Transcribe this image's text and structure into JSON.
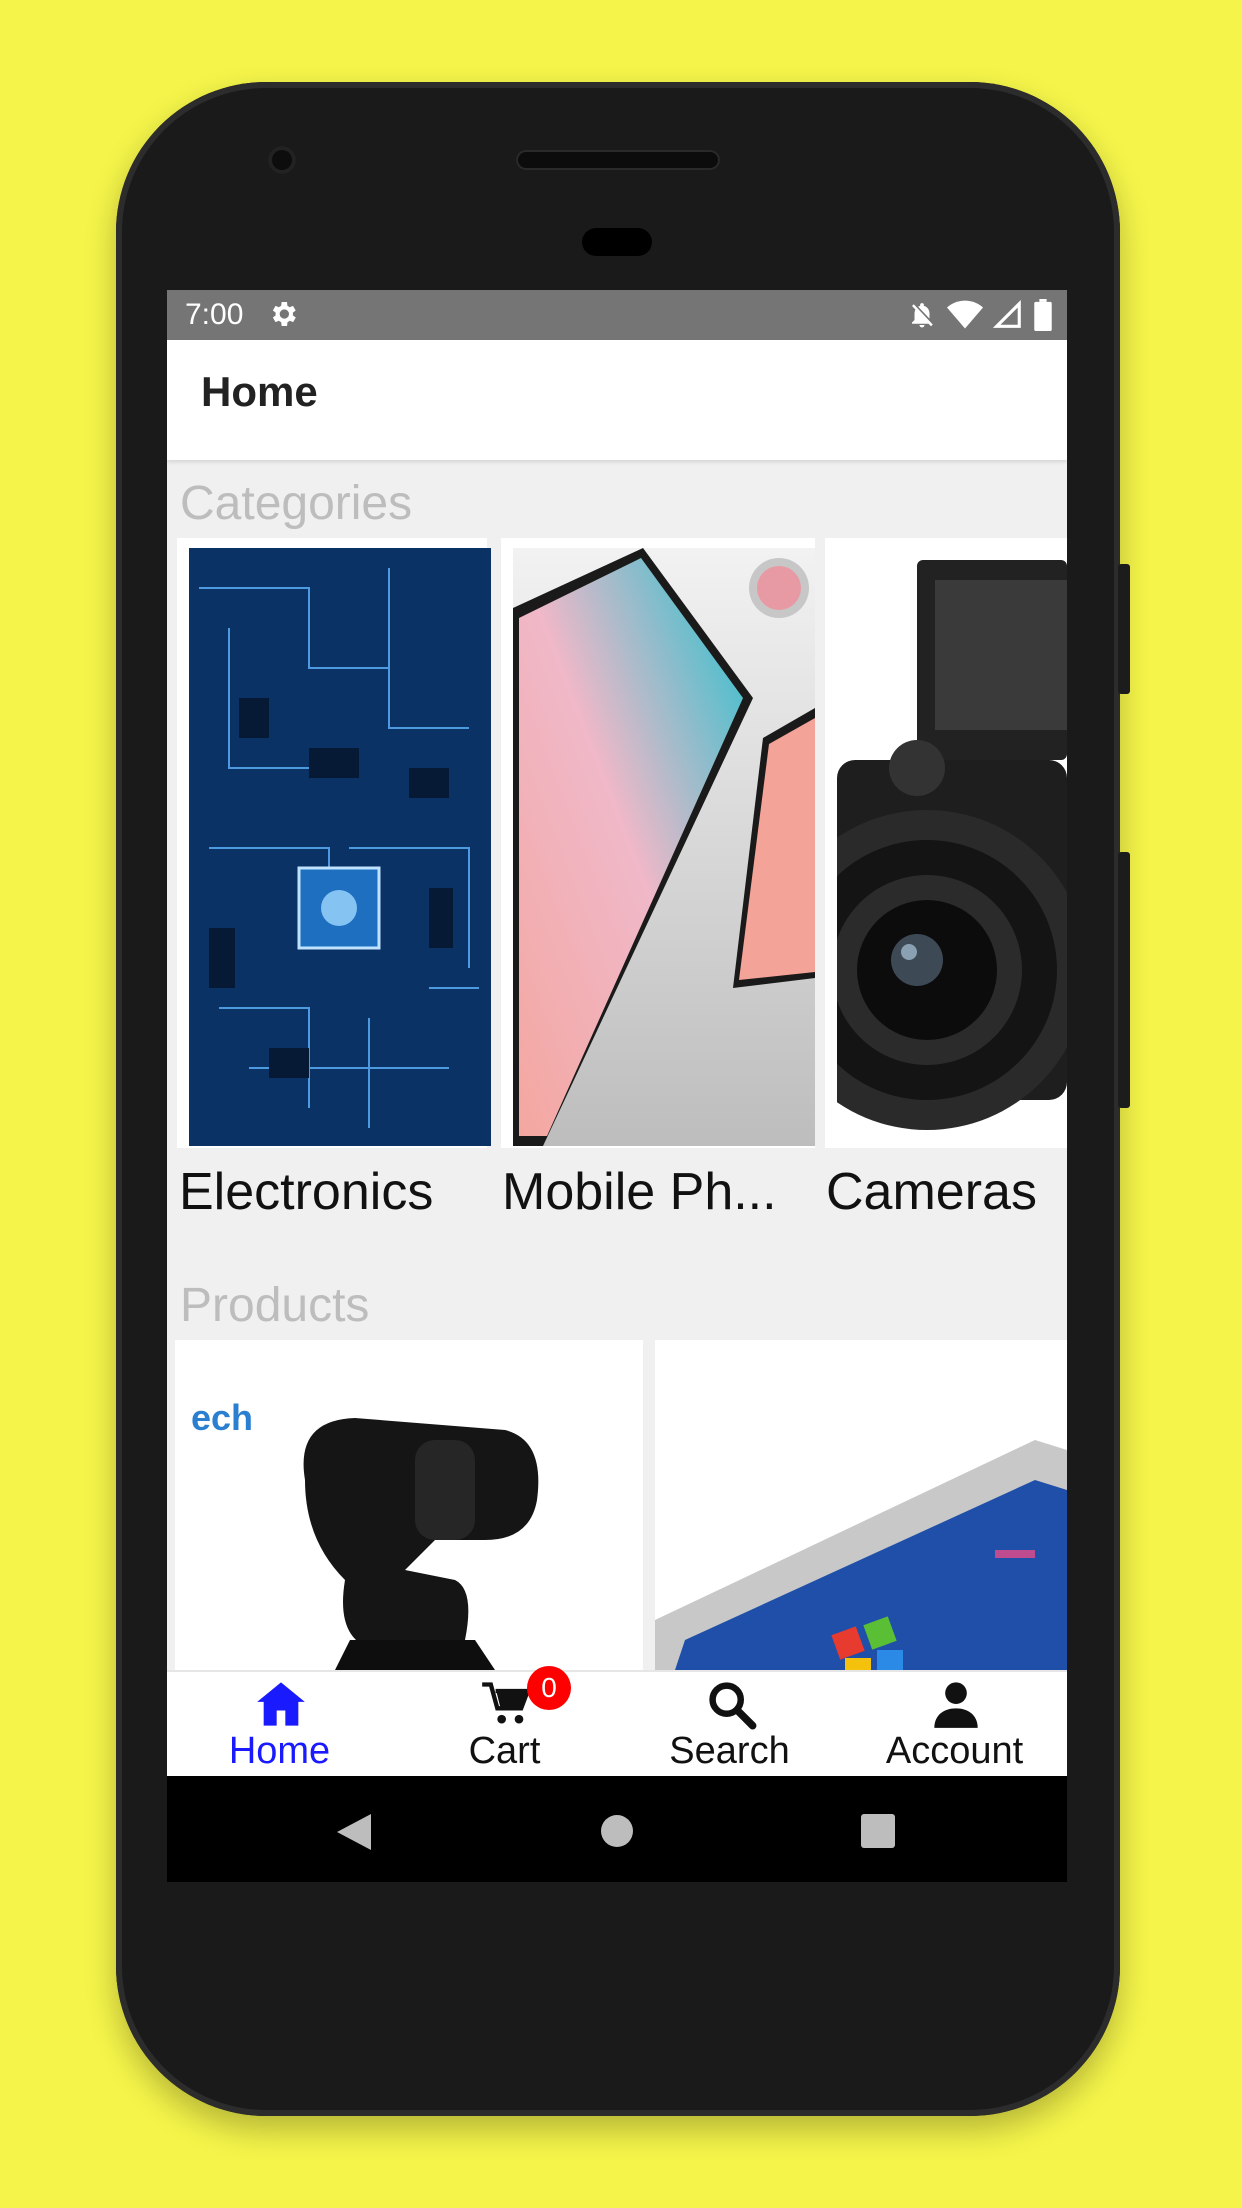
{
  "status_bar": {
    "time": "7:00",
    "icons": [
      "gear-icon",
      "notifications-off-icon",
      "wifi-icon",
      "signal-icon",
      "battery-icon"
    ]
  },
  "app_bar": {
    "title": "Home"
  },
  "categories": {
    "heading": "Categories",
    "items": [
      {
        "label": "Electronics",
        "image": "circuit-board-image"
      },
      {
        "label": "Mobile Ph...",
        "image": "tablet-phone-image"
      },
      {
        "label": "Cameras",
        "image": "camera-image"
      }
    ]
  },
  "products": {
    "heading": "Products",
    "items": [
      {
        "image": "webcam-image"
      },
      {
        "image": "laptop-image"
      }
    ]
  },
  "bottom_nav": {
    "items": [
      {
        "label": "Home",
        "icon": "home-icon",
        "active": true
      },
      {
        "label": "Cart",
        "icon": "cart-icon",
        "badge": "0"
      },
      {
        "label": "Search",
        "icon": "search-icon"
      },
      {
        "label": "Account",
        "icon": "account-icon"
      }
    ]
  },
  "colors": {
    "background": "#f4f44a",
    "accent": "#1a1aff",
    "badge": "#ff0000",
    "status_bar": "#757575"
  }
}
